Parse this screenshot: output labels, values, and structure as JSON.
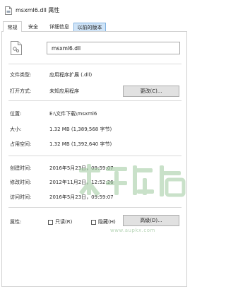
{
  "window": {
    "title": "msxml6.dll 属性"
  },
  "tabs": [
    {
      "label": "常规",
      "active": true
    },
    {
      "label": "安全",
      "active": false
    },
    {
      "label": "详细信息",
      "active": false
    },
    {
      "label": "以前的版本",
      "active": false
    }
  ],
  "general": {
    "file_name": "msxml6.dll",
    "rows": {
      "file_type": {
        "label": "文件类型:",
        "value": "应用程序扩展 (.dll)"
      },
      "opens_with": {
        "label": "打开方式:",
        "value": "未知应用程序"
      },
      "location": {
        "label": "位置:",
        "value": "E:\\文件下载\\msxml6"
      },
      "size": {
        "label": "大小:",
        "value": "1.32 MB (1,389,568 字节)"
      },
      "size_on_disk": {
        "label": "占用空间:",
        "value": "1.32 MB (1,392,640 字节)"
      },
      "created": {
        "label": "创建时间:",
        "value": "2016年5月23日，09:59:07"
      },
      "modified": {
        "label": "修改时间:",
        "value": "2012年11月2日，12:52:26"
      },
      "accessed": {
        "label": "访问时间:",
        "value": "2016年5月23日，09:59:07"
      },
      "attributes": {
        "label": "属性:"
      }
    },
    "change_button": "更改(C)...",
    "readonly_label": "只读(R)",
    "hidden_label": "隐藏(H)",
    "advanced_button": "高级(D)...",
    "readonly_checked": false,
    "hidden_checked": false
  },
  "watermark": {
    "site": "www.aupkx.com"
  },
  "icons": {
    "title": "file-icon",
    "file": "dll-file-icon"
  },
  "colors": {
    "highlight_tab": "#cfe4f8",
    "button_bg": "#e1e1e1",
    "watermark": "#9ec99e"
  }
}
